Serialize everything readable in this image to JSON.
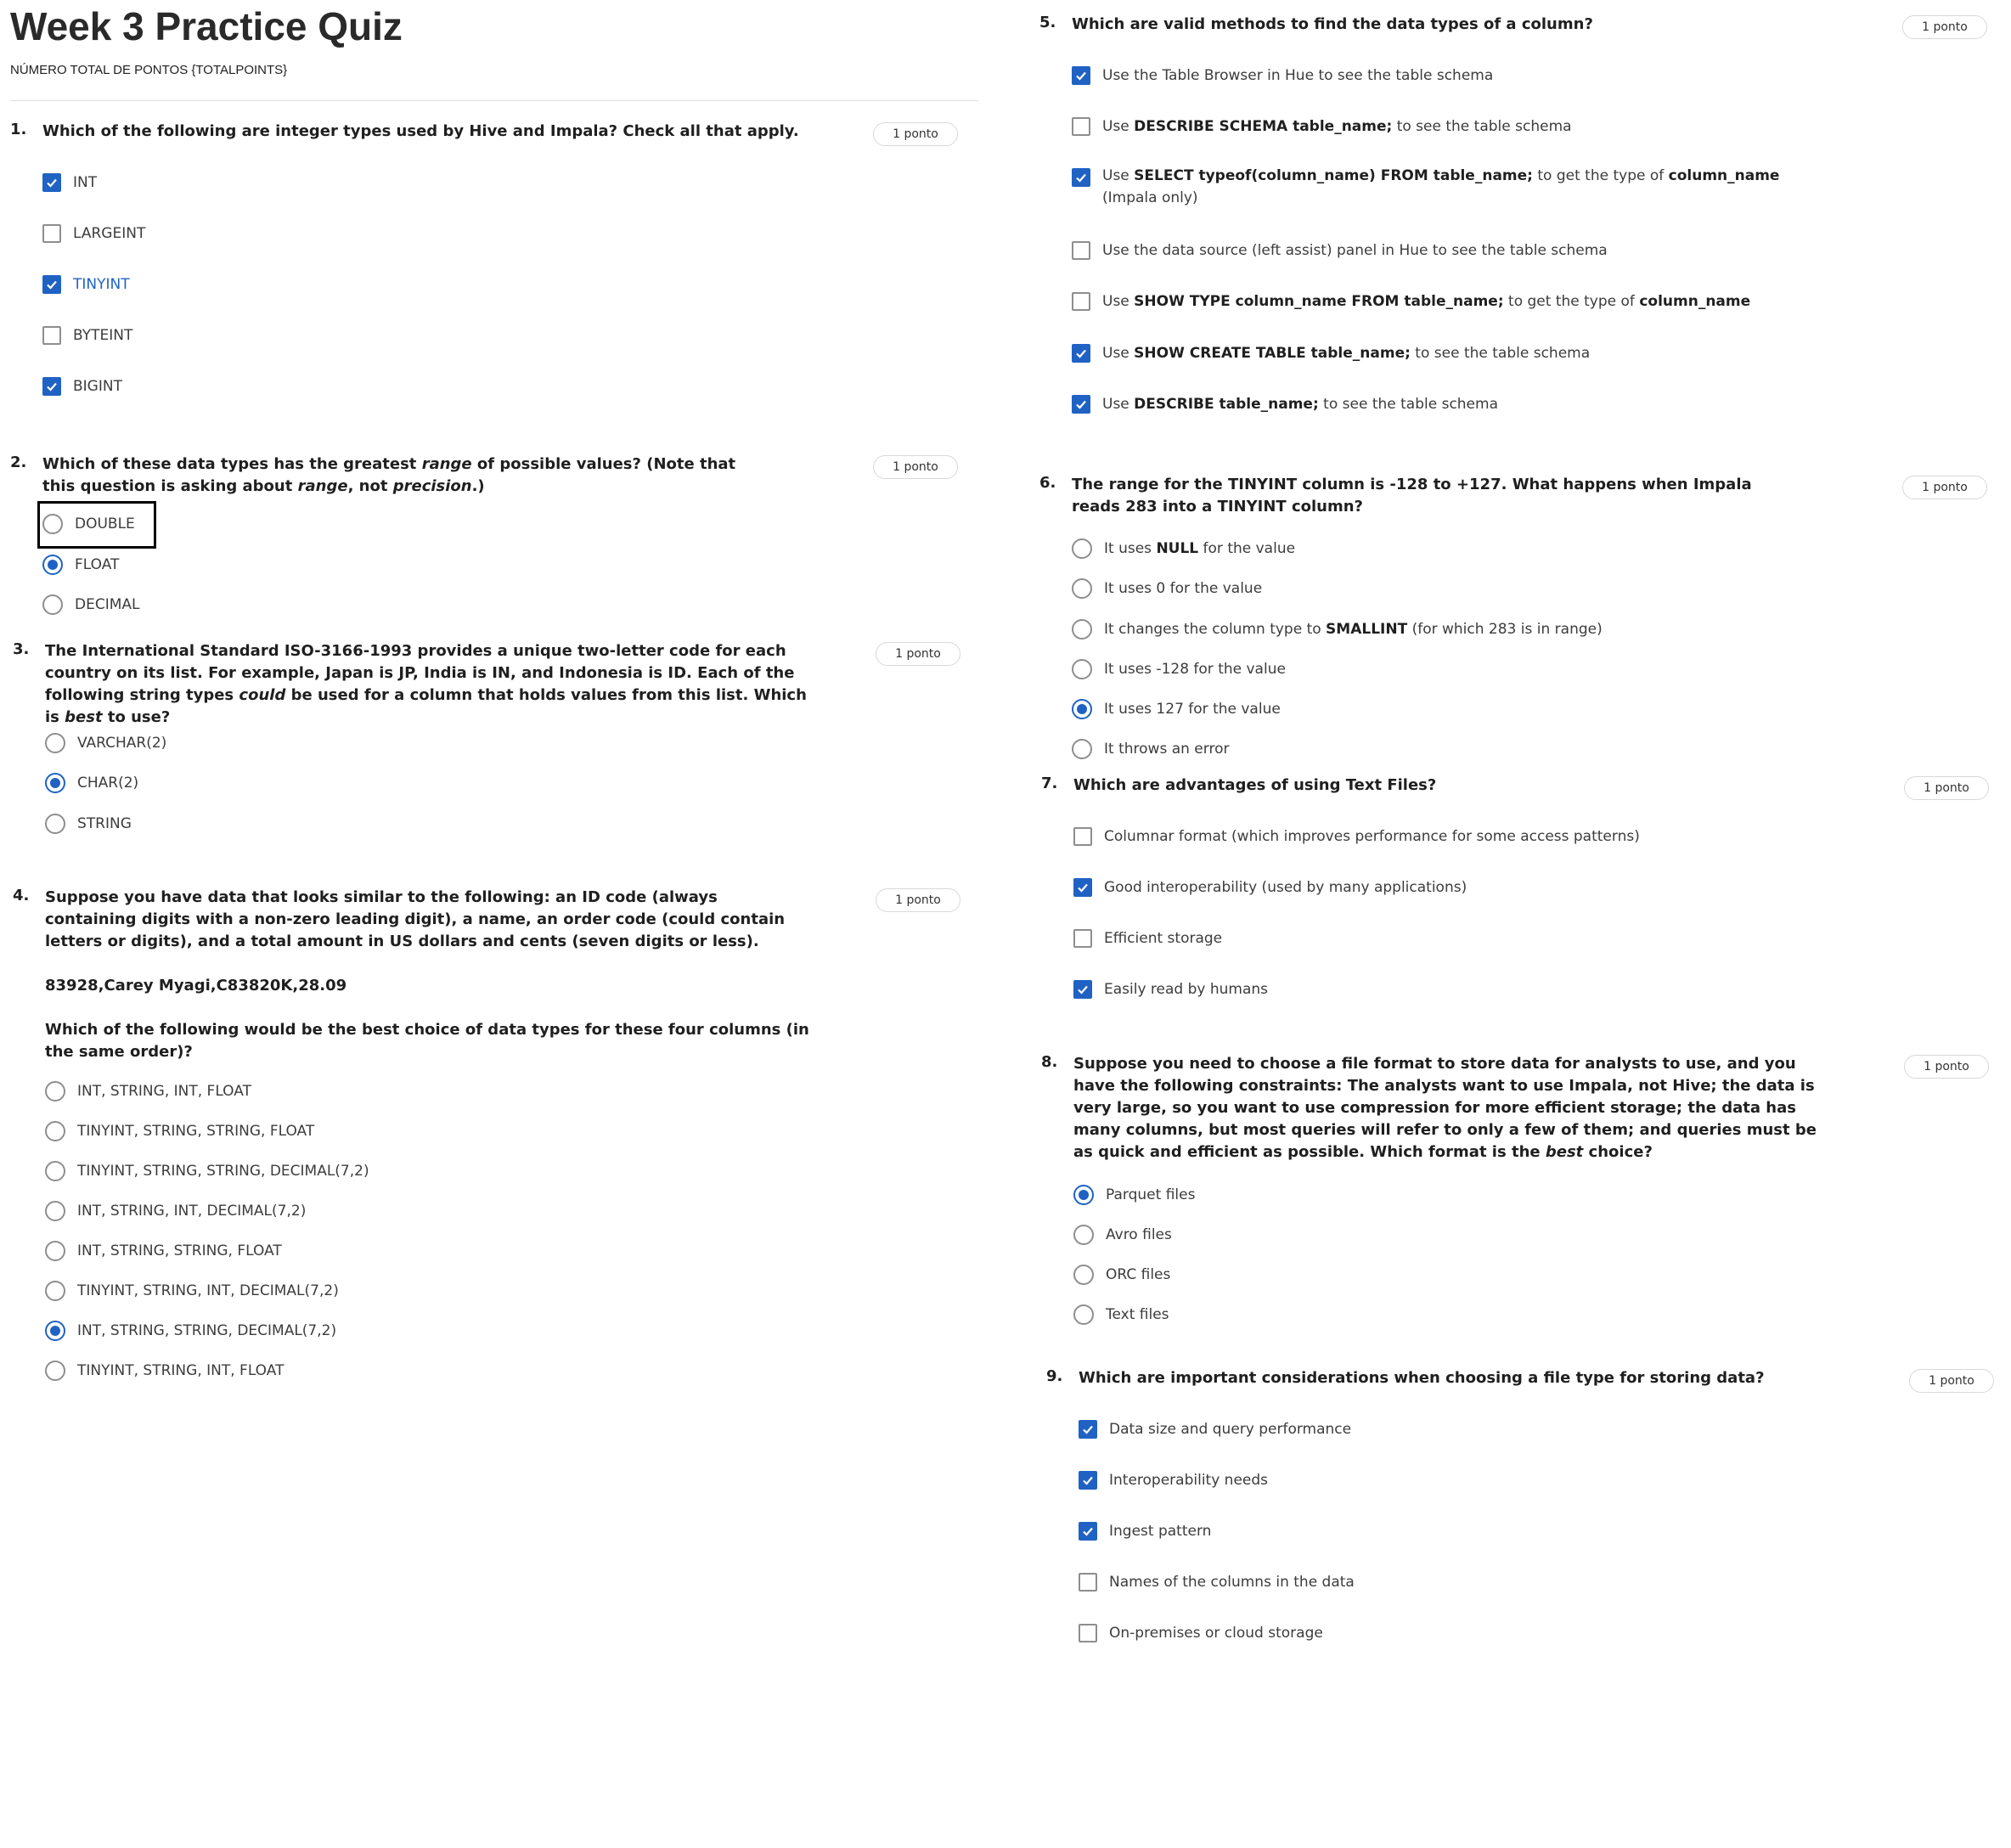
{
  "quiz": {
    "title": "Week 3 Practice Quiz",
    "total_points": "NÚMERO TOTAL DE PONTOS {TOTALPOINTS}"
  },
  "questions": [
    {
      "number": "1.",
      "text": "Which of the following are integer types used by Hive and Impala? Check all that apply.",
      "points": "1 ponto",
      "type": "checkbox",
      "options": [
        {
          "label": "INT",
          "checked": true
        },
        {
          "label": "LARGEINT",
          "checked": false
        },
        {
          "label": "TINYINT",
          "checked": true
        },
        {
          "label": "BYTEINT",
          "checked": false
        },
        {
          "label": "BIGINT",
          "checked": true
        }
      ]
    },
    {
      "number": "2.",
      "text_parts": [
        "Which of these data types has the greatest ",
        "range",
        " of possible values? (Note that this question is asking about ",
        "range",
        ", not ",
        "precision",
        ".)"
      ],
      "points": "1 ponto",
      "type": "radio",
      "options": [
        {
          "label": "DOUBLE",
          "checked": false
        },
        {
          "label": "FLOAT",
          "checked": true
        },
        {
          "label": "DECIMAL",
          "checked": false
        }
      ]
    },
    {
      "number": "3.",
      "text_parts": [
        "The International Standard ISO-3166-1993 provides a unique two-letter code for each country on its list. For example, Japan is JP, India is IN, and Indonesia is ID. Each of the following string types ",
        "could",
        " be used for a column that holds values from this list. Which is ",
        "best",
        " to use?"
      ],
      "points": "1 ponto",
      "type": "radio",
      "options": [
        {
          "label": "VARCHAR(2)",
          "checked": false
        },
        {
          "label": "CHAR(2)",
          "checked": true
        },
        {
          "label": "STRING",
          "checked": false
        }
      ]
    },
    {
      "number": "4.",
      "text": "Suppose you have data that looks similar to the following: an ID code (always containing digits with a non-zero leading digit), a name, an order code (could contain letters or digits), and a total amount in US dollars and cents (seven digits or less).",
      "sample": "83928,Carey Myagi,C83820K,28.09",
      "text2": "Which of the following would be the best choice of data types for these four columns (in the same order)?",
      "points": "1 ponto",
      "type": "radio",
      "options": [
        {
          "label": "INT, STRING, INT, FLOAT",
          "checked": false
        },
        {
          "label": "TINYINT, STRING, STRING, FLOAT",
          "checked": false
        },
        {
          "label": "TINYINT, STRING, STRING, DECIMAL(7,2)",
          "checked": false
        },
        {
          "label": "INT, STRING, INT, DECIMAL(7,2)",
          "checked": false
        },
        {
          "label": "INT, STRING, STRING, FLOAT",
          "checked": false
        },
        {
          "label": "TINYINT, STRING, INT, DECIMAL(7,2)",
          "checked": false
        },
        {
          "label": "INT, STRING, STRING, DECIMAL(7,2)",
          "checked": true
        },
        {
          "label": "TINYINT, STRING, INT, FLOAT",
          "checked": false
        }
      ]
    },
    {
      "number": "5.",
      "text": "Which are valid methods to find the data types of a column?",
      "points": "1 ponto",
      "type": "checkbox",
      "options": [
        {
          "parts": [
            "Use the Table Browser in Hue to see the table schema"
          ],
          "checked": true
        },
        {
          "parts": [
            "Use ",
            "DESCRIBE SCHEMA table_name;",
            " to see the table schema"
          ],
          "checked": false
        },
        {
          "parts": [
            "Use ",
            "SELECT typeof(column_name) FROM table_name;",
            " to get the type of ",
            "column_name",
            " (Impala only)"
          ],
          "checked": true
        },
        {
          "parts": [
            "Use the data source (left assist) panel in Hue to see the table schema"
          ],
          "checked": false
        },
        {
          "parts": [
            "Use ",
            "SHOW TYPE column_name FROM table_name;",
            " to get the type of ",
            "column_name"
          ],
          "checked": false
        },
        {
          "parts": [
            "Use ",
            "SHOW CREATE TABLE table_name;",
            " to see the table schema"
          ],
          "checked": true
        },
        {
          "parts": [
            "Use ",
            "DESCRIBE table_name;",
            " to see the table schema"
          ],
          "checked": true
        }
      ]
    },
    {
      "number": "6.",
      "text": "The range for the TINYINT column is -128 to +127. What happens when Impala reads 283 into a TINYINT column?",
      "points": "1 ponto",
      "type": "radio",
      "options": [
        {
          "parts": [
            "It uses ",
            "NULL",
            " for the value"
          ],
          "checked": false
        },
        {
          "parts": [
            "It uses 0 for the value"
          ],
          "checked": false
        },
        {
          "parts": [
            "It changes the column type to ",
            "SMALLINT",
            " (for which 283 is in range)"
          ],
          "checked": false
        },
        {
          "parts": [
            "It uses -128 for the value"
          ],
          "checked": false
        },
        {
          "parts": [
            "It uses 127 for the value"
          ],
          "checked": true
        },
        {
          "parts": [
            "It throws an error"
          ],
          "checked": false
        }
      ]
    },
    {
      "number": "7.",
      "text": "Which are advantages of using Text Files?",
      "points": "1 ponto",
      "type": "checkbox",
      "options": [
        {
          "label": "Columnar format (which improves performance for some access patterns)",
          "checked": false
        },
        {
          "label": "Good interoperability (used by many applications)",
          "checked": true
        },
        {
          "label": "Efficient storage",
          "checked": false
        },
        {
          "label": "Easily read by humans",
          "checked": true
        }
      ]
    },
    {
      "number": "8.",
      "text_parts": [
        "Suppose you need to choose a file format to store data for analysts to use, and you have the following constraints: The analysts want to use Impala, not Hive; the data is very large, so you want to use compression for more efficient storage; the data has many columns, but most queries will refer to only a few of them; and queries must be as quick and efficient as possible. Which format is the ",
        "best",
        " choice?"
      ],
      "points": "1 ponto",
      "type": "radio",
      "options": [
        {
          "label": "Parquet files",
          "checked": true
        },
        {
          "label": "Avro files",
          "checked": false
        },
        {
          "label": "ORC files",
          "checked": false
        },
        {
          "label": "Text files",
          "checked": false
        }
      ]
    },
    {
      "number": "9.",
      "text": "Which are important considerations when choosing a file type for storing data?",
      "points": "1 ponto",
      "type": "checkbox",
      "options": [
        {
          "label": "Data size and query performance",
          "checked": true
        },
        {
          "label": "Interoperability needs",
          "checked": true
        },
        {
          "label": "Ingest pattern",
          "checked": true
        },
        {
          "label": "Names of the columns in the data",
          "checked": false
        },
        {
          "label": "On-premises or cloud storage",
          "checked": false
        }
      ]
    }
  ],
  "colors": {
    "accent": "#1f62c4",
    "border": "#8e8e8e",
    "focus_outline": "#000000"
  },
  "icons": {
    "checked": "check-icon"
  }
}
